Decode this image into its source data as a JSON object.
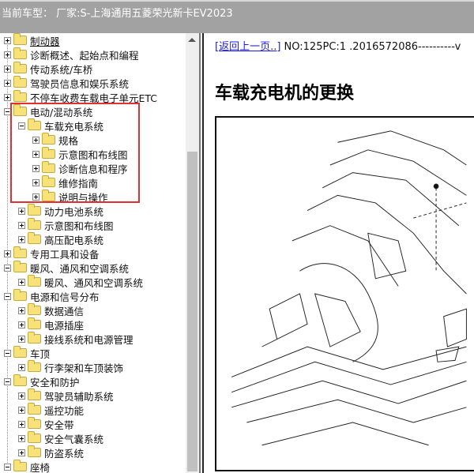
{
  "header": {
    "title": "当前车型：  厂家:S-上海通用五菱荣光新卡EV2023"
  },
  "tree": [
    {
      "label": "制动器",
      "level": 0,
      "expanded": false,
      "selected": true
    },
    {
      "label": "诊断概述、起始点和编程",
      "level": 0,
      "expanded": false
    },
    {
      "label": "传动系统/车桥",
      "level": 0,
      "expanded": false
    },
    {
      "label": "驾驶员信息和娱乐系统",
      "level": 0,
      "expanded": false
    },
    {
      "label": "不停车收费车载电子单元ETC",
      "level": 0,
      "expanded": false
    },
    {
      "label": "电动/混动系统",
      "level": 0,
      "expanded": true
    },
    {
      "label": "车载充电系统",
      "level": 1,
      "expanded": true
    },
    {
      "label": "规格",
      "level": 2,
      "expanded": false
    },
    {
      "label": "示意图和布线图",
      "level": 2,
      "expanded": false
    },
    {
      "label": "诊断信息和程序",
      "level": 2,
      "expanded": false
    },
    {
      "label": "维修指南",
      "level": 2,
      "expanded": false
    },
    {
      "label": "说明与操作",
      "level": 2,
      "expanded": false
    },
    {
      "label": "动力电池系统",
      "level": 1,
      "expanded": false
    },
    {
      "label": "示意图和布线图",
      "level": 1,
      "expanded": false
    },
    {
      "label": "高压配电系统",
      "level": 1,
      "expanded": false
    },
    {
      "label": "专用工具和设备",
      "level": 0,
      "expanded": false
    },
    {
      "label": "暖风、通风和空调系统",
      "level": 0,
      "expanded": true
    },
    {
      "label": "暖风、通风和空调系统",
      "level": 1,
      "expanded": false
    },
    {
      "label": "电源和信号分布",
      "level": 0,
      "expanded": true
    },
    {
      "label": "数据通信",
      "level": 1,
      "expanded": false
    },
    {
      "label": "电源插座",
      "level": 1,
      "expanded": false
    },
    {
      "label": "接线系统和电源管理",
      "level": 1,
      "expanded": false
    },
    {
      "label": "车顶",
      "level": 0,
      "expanded": true
    },
    {
      "label": "行李架和车顶装饰",
      "level": 1,
      "expanded": false
    },
    {
      "label": "安全和防护",
      "level": 0,
      "expanded": true
    },
    {
      "label": "驾驶员辅助系统",
      "level": 1,
      "expanded": false
    },
    {
      "label": "遥控功能",
      "level": 1,
      "expanded": false
    },
    {
      "label": "安全带",
      "level": 1,
      "expanded": false
    },
    {
      "label": "安全气囊系统",
      "level": 1,
      "expanded": false
    },
    {
      "label": "防盗系统",
      "level": 1,
      "expanded": false
    },
    {
      "label": "座椅",
      "level": 0,
      "expanded": true
    }
  ],
  "content": {
    "back_link": "[返回上一页..]",
    "doc_info": " NO:125PC:1 .2016572086----------v",
    "title": "车载充电机的更换"
  },
  "colors": {
    "highlight_box": "#e03030",
    "link": "#1a1aee",
    "header_bg": "#a2a2a2"
  }
}
